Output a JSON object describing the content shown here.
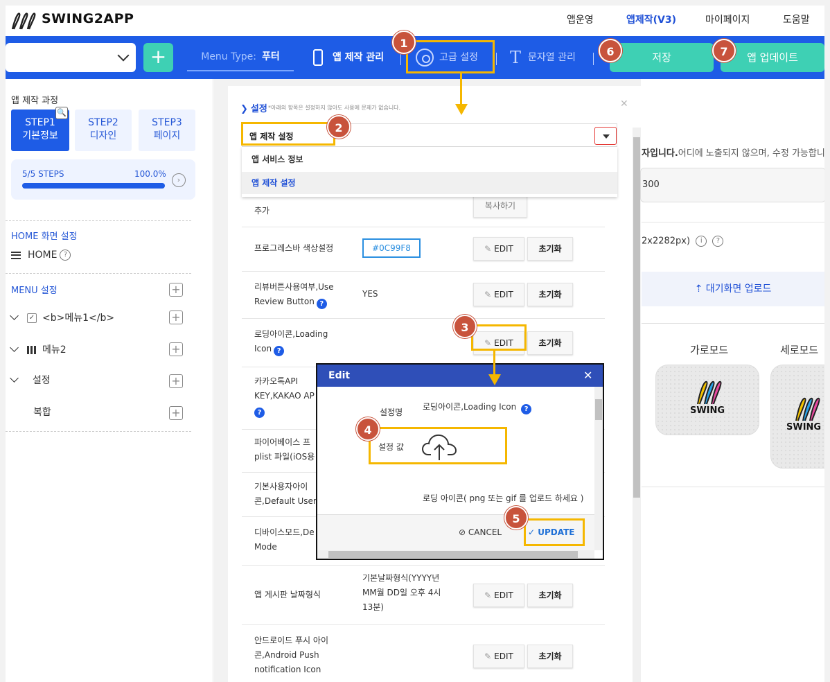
{
  "brand": {
    "name": "SWING2APP"
  },
  "topnav": {
    "items": [
      "앱운영",
      "앱제작(V3)",
      "마이페이지",
      "도움말"
    ],
    "active": "앱제작(V3)"
  },
  "toolbar": {
    "menu_type_label": "Menu Type:",
    "menu_type_value": "푸터",
    "app_manage": "앱 제작 관리",
    "advanced": "고급 설정",
    "string_manage": "문자열 관리",
    "save": "저장",
    "app_update": "앱 업데이트",
    "plus": "+"
  },
  "sidebar": {
    "title": "앱 제작 과정",
    "steps": [
      {
        "line1": "STEP1",
        "line2": "기본정보"
      },
      {
        "line1": "STEP2",
        "line2": "디자인"
      },
      {
        "line1": "STEP3",
        "line2": "페이지"
      }
    ],
    "progress_label": "5/5 STEPS",
    "progress_percent": "100.0%",
    "progress_fraction": 1.0,
    "home_title": "HOME 화면 설정",
    "home_item": "HOME",
    "menu_title": "MENU 설정",
    "menu_items": [
      "<b>메뉴1</b>",
      "메뉴2",
      "설정",
      "복합"
    ]
  },
  "panel": {
    "title": "설정",
    "note": "*아래의 항목은 설정하지 않아도 사용에 문제가 없습니다.",
    "select_value": "앱 제작 설정",
    "dropdown_options": [
      "앱 서비스 정보",
      "앱 제작 설정"
    ],
    "partial_row_name": "추가",
    "partial_row_button": "복사하기",
    "rows": [
      {
        "name": "프로그레스바 색상설정",
        "value": "#0C99F8"
      },
      {
        "name1": "리뷰버튼사용여부,Use",
        "name2": "Review Button",
        "value": "YES"
      },
      {
        "name1": "로딩아이콘,Loading",
        "name2": "Icon"
      },
      {
        "name1": "카카오톡API",
        "name2": "KEY,KAKAO AP"
      },
      {
        "name1": "파이어베이스 프",
        "name2": "plist 파일(iOS용"
      },
      {
        "name1": "기본사용자아이",
        "name2": "콘,Default User"
      },
      {
        "name1": "디바이스모드,De",
        "name2": "Mode"
      },
      {
        "name": "앱 게시판 날짜형식",
        "value1": "기본날짜형식(YYYY년",
        "value2": "MM월 DD일 오후 4시",
        "value3": "13분)"
      },
      {
        "name1": "안드로이드 푸시 아이",
        "name2": "콘,Android Push",
        "name3": "notification Icon"
      }
    ],
    "edit_label": "EDIT",
    "reset_label": "초기화",
    "question_mark": "?"
  },
  "right": {
    "text_bold": "자입니다.",
    "text_rest": "어디에 노출되지 않으며, 수정 가능합니",
    "input_value": "300",
    "size_text": "2x2282px)",
    "upload": "대기화면 업로드",
    "mode_landscape": "가로모드",
    "mode_portrait": "세로모드",
    "logo_text": "SWING"
  },
  "modal": {
    "title": "Edit",
    "field_name_label": "설정명",
    "field_name_value": "로딩아이콘,Loading Icon",
    "field_value_label": "설정 값",
    "hint": "로딩 아이콘( png 또는 gif 를 업로드 하세요 )",
    "cancel": "CANCEL",
    "update": "UPDATE"
  },
  "badges": [
    "1",
    "2",
    "3",
    "4",
    "5",
    "6",
    "7"
  ],
  "colors": {
    "primary": "#1e5ce6",
    "accent": "#3ed0b4",
    "highlight": "#f5b700",
    "badge": "#c8533c",
    "modal_header": "#2f4fb8"
  }
}
